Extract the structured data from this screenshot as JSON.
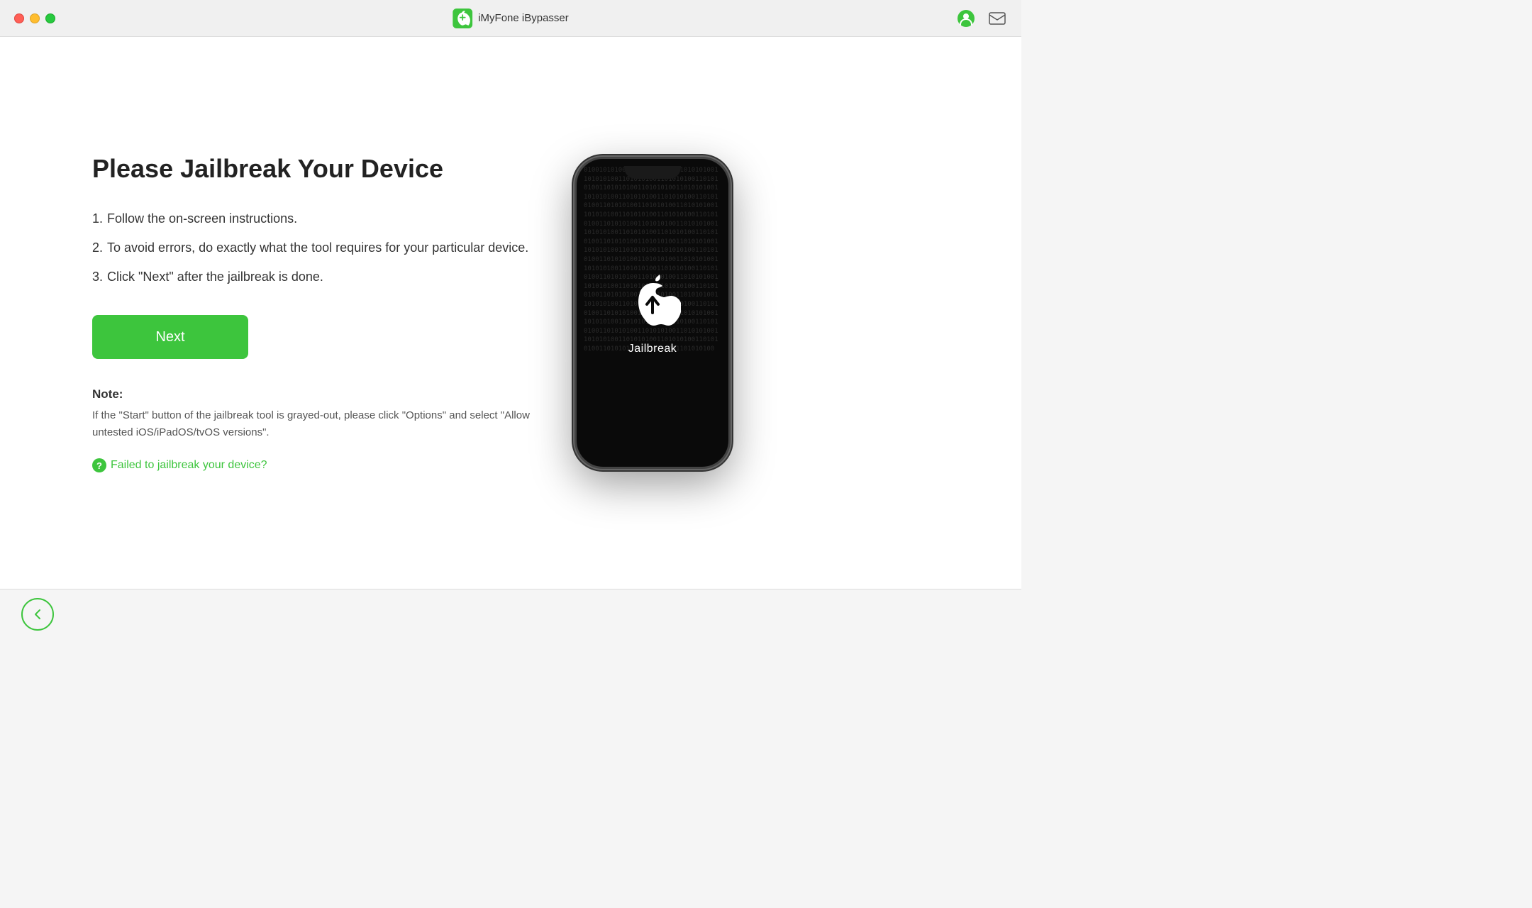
{
  "titleBar": {
    "appName": "iMyFone iBypasser",
    "logoAlt": "iMyFone logo"
  },
  "header": {
    "title": "Please Jailbreak Your Device"
  },
  "instructions": [
    {
      "num": "1.",
      "text": "Follow the on-screen instructions."
    },
    {
      "num": "2.",
      "text": "To avoid errors, do exactly what the tool requires for your particular device."
    },
    {
      "num": "3.",
      "text": "Click \"Next\" after the jailbreak is done."
    }
  ],
  "buttons": {
    "next": "Next"
  },
  "note": {
    "title": "Note:",
    "text": "If the \"Start\" button of the jailbreak tool is grayed-out, please click \"Options\" and select \"Allow untested iOS/iPadOS/tvOS versions\"."
  },
  "failedLink": {
    "text": "Failed to jailbreak your device?"
  },
  "phone": {
    "label": "Jailbreak",
    "bgText": "01001010100110101010010011010101001101010100110101010011010101001101010100110101010011010101001101010100110101010011010101001101010100110101010011010101001101010100110101010011010101001101010100110101010011010101001101010100110101010011010101001101010100110101010011010101001101010100110101010011010101001101010100110101010011010101001101010100110101010011010101001101010100110101010011010101001101010100110101010011010101001101010100110101010011010101001101010100110101010011010101001101010100110101010011010101001101010100110101010011010101001101010100110101010011010101001101010100110101010011010101001101010100110101010011010101001101010100110101010011010101001101010100110101010011010101001101010100110101010011010101001101010100"
  },
  "colors": {
    "green": "#3dc53d",
    "darkGreen": "#35b535",
    "textDark": "#222",
    "textMed": "#333",
    "textLight": "#555"
  }
}
